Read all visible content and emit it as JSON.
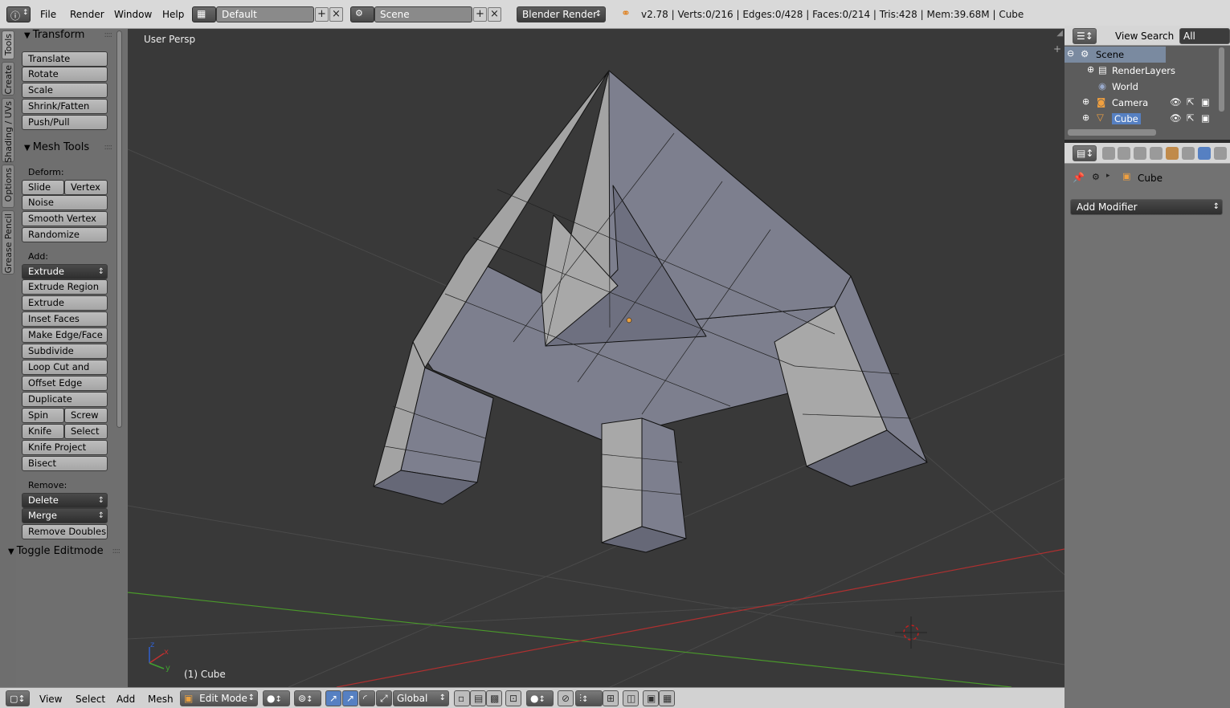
{
  "topbar": {
    "menus": [
      "File",
      "Render",
      "Window",
      "Help"
    ],
    "screen_layout": "Default",
    "scene": "Scene",
    "render_engine": "Blender Render",
    "stats": "v2.78 | Verts:0/216 | Edges:0/428 | Faces:0/214 | Tris:428 | Mem:39.68M | Cube"
  },
  "left_tabs": [
    "Tools",
    "Create",
    "Shading / UVs",
    "Options",
    "Grease Pencil"
  ],
  "toolshelf": {
    "transform": {
      "title": "Transform",
      "buttons": [
        "Translate",
        "Rotate",
        "Scale",
        "Shrink/Fatten",
        "Push/Pull"
      ]
    },
    "mesh_tools": {
      "title": "Mesh Tools",
      "deform_label": "Deform:",
      "slide_edge": "Slide Ed",
      "vertex": "Vertex",
      "noise": "Noise",
      "smooth_vertex": "Smooth Vertex",
      "randomize": "Randomize",
      "add_label": "Add:",
      "extrude": "Extrude",
      "extrude_region": "Extrude Region",
      "extrude_individual": "Extrude Individual",
      "inset_faces": "Inset Faces",
      "make_edge_face": "Make Edge/Face",
      "subdivide": "Subdivide",
      "loop_cut": "Loop Cut and Slide",
      "offset_edge": "Offset Edge Slide",
      "duplicate": "Duplicate",
      "spin": "Spin",
      "screw": "Screw",
      "knife": "Knife",
      "select": "Select",
      "knife_project": "Knife Project",
      "bisect": "Bisect",
      "remove_label": "Remove:",
      "delete": "Delete",
      "merge": "Merge",
      "remove_doubles": "Remove Doubles"
    },
    "toggle_editmode": "Toggle Editmode"
  },
  "viewport": {
    "view_label": "User Persp",
    "object_label": "(1) Cube",
    "axis_labels": {
      "x": "x",
      "y": "y",
      "z": "z"
    }
  },
  "bottombar": {
    "menus": [
      "View",
      "Select",
      "Add",
      "Mesh"
    ],
    "mode": "Edit Mode",
    "orientation": "Global"
  },
  "outliner": {
    "header_items": [
      "View",
      "Search",
      "All Scenes"
    ],
    "rows": [
      {
        "label": "Scene",
        "icon": "scene-icon"
      },
      {
        "label": "RenderLayers",
        "icon": "renderlayers-icon"
      },
      {
        "label": "World",
        "icon": "world-icon"
      },
      {
        "label": "Camera",
        "icon": "camera-icon"
      },
      {
        "label": "Cube",
        "icon": "mesh-icon"
      }
    ]
  },
  "properties": {
    "context_object": "Cube",
    "add_modifier": "Add Modifier"
  },
  "colors": {
    "accent_blue": "#5680c2",
    "mesh_face": "#7d7f8e",
    "mesh_face_light": "#a3a3a3",
    "viewport_bg": "#393939",
    "x_axis": "#b03030",
    "y_axis": "#4a9a2a"
  }
}
